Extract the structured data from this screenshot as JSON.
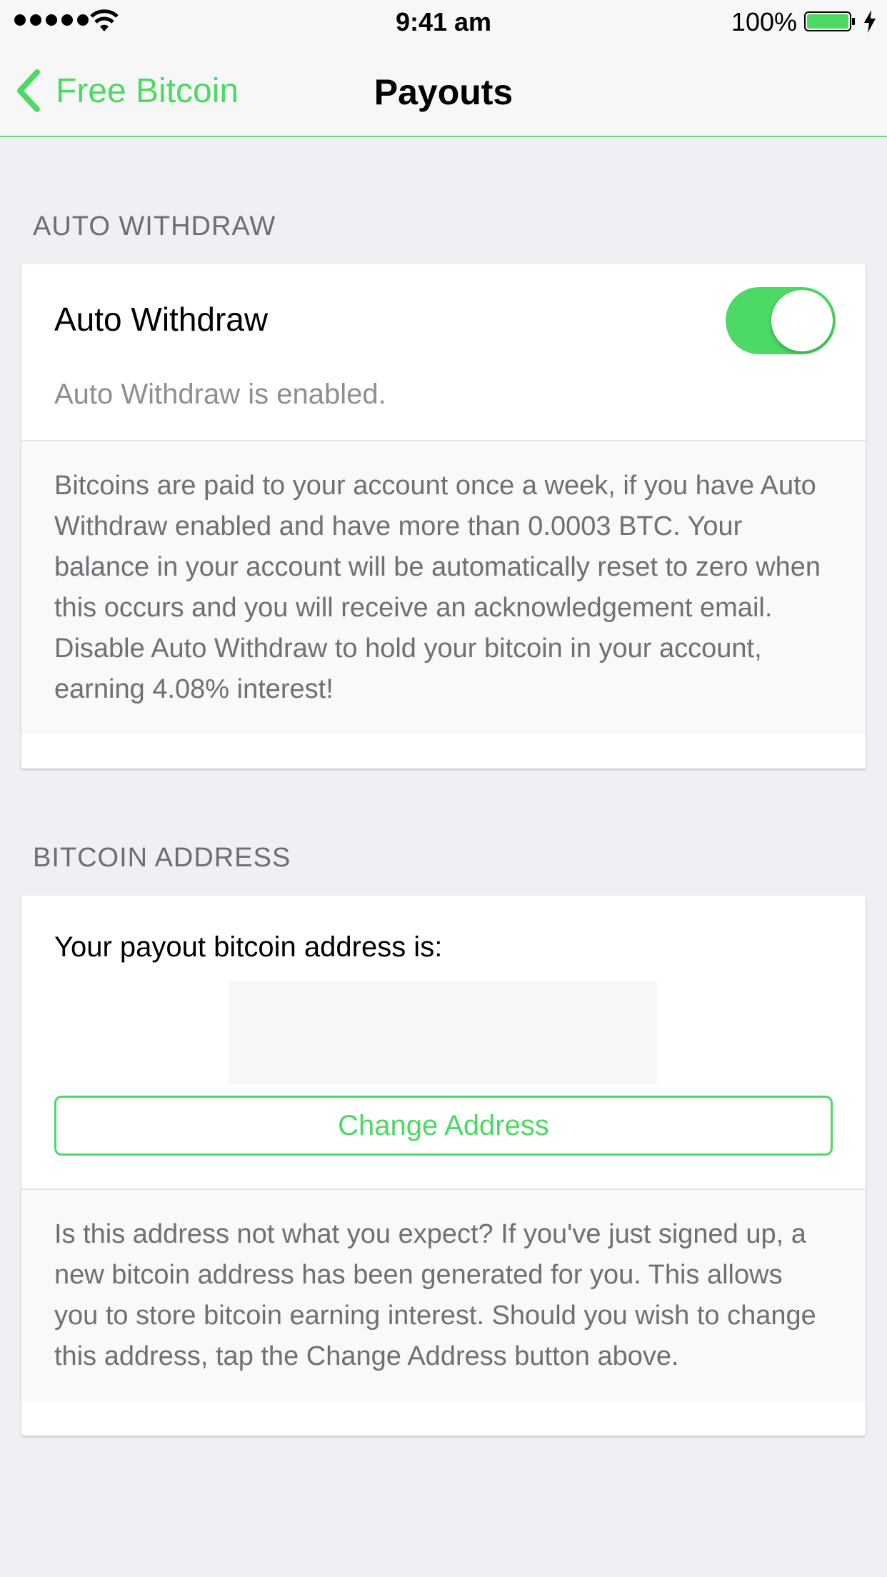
{
  "status_bar": {
    "time": "9:41 am",
    "battery_percent": "100%"
  },
  "nav": {
    "back_label": "Free Bitcoin",
    "title": "Payouts"
  },
  "auto_withdraw": {
    "section_header": "AUTO WITHDRAW",
    "toggle_label": "Auto Withdraw",
    "toggle_on": true,
    "status_text": "Auto Withdraw is enabled.",
    "description": "Bitcoins are paid to your account once a week, if you have Auto Withdraw enabled and have more than 0.0003 BTC. Your balance in your account will be automatically reset to zero when this occurs and you will receive an acknowledgement email. Disable Auto Withdraw to hold your bitcoin in your account, earning 4.08% interest!"
  },
  "bitcoin_address": {
    "section_header": "BITCOIN ADDRESS",
    "label": "Your payout bitcoin address is:",
    "change_button_label": "Change Address",
    "description": "Is this address not what you expect? If you've just signed up, a new bitcoin address has been generated for you. This allows you to store bitcoin earning interest. Should you wish to change this address, tap the Change Address button above."
  },
  "colors": {
    "accent": "#4cd964",
    "background": "#efeff4"
  }
}
